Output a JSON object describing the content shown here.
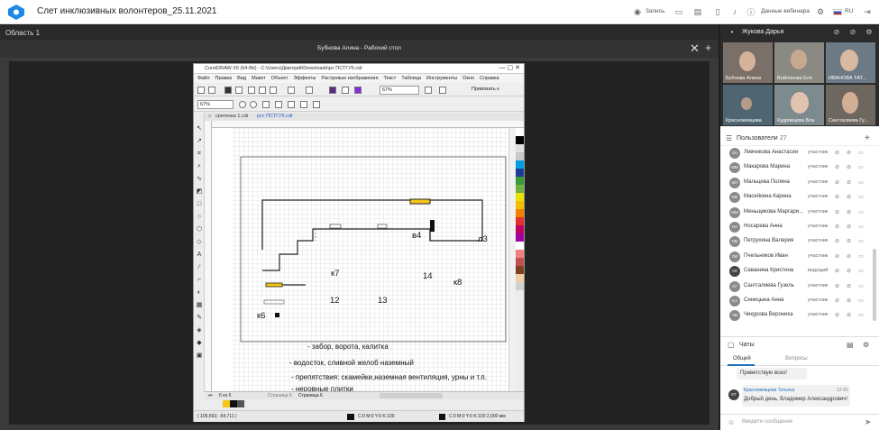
{
  "app": {
    "title": "Слет инклюзивных волонтеров_25.11.2021",
    "record_label": "Запись",
    "webinar_data_label": "Данные вебинара",
    "language": "RU",
    "accent_color": "#1e88e5"
  },
  "area": {
    "title": "Область 1"
  },
  "stage": {
    "title": "Бубнова Алина - Рабочий стол"
  },
  "corel": {
    "title": "CorelDRAW X6 (64-Bit) - C:\\Users\\Дмитрий\\Downloads\\рс ПСТГУ5.cdr",
    "menu": [
      "Файл",
      "Правка",
      "Вид",
      "Макет",
      "Объект",
      "Эффекты",
      "Растровые изображения",
      "Текст",
      "Таблица",
      "Инструменты",
      "Окно",
      "Справка"
    ],
    "zoom1": "67%",
    "zoom2": "67%",
    "snap_label": "Привязать к",
    "tabs": [
      "сретенка 1.cdr",
      "рсс ПСТГУ5.cdr"
    ],
    "page_nav": "6 из 6",
    "pages": [
      "Страница 5",
      "Страница 6"
    ],
    "coords": "( 105,663; -54,711 )",
    "fill_status": "C:0 M:0 Y:0 K:100",
    "outline_status": "C:0 M:0 Y:0 K:100  2,000 мм",
    "drawing": {
      "labels": [
        "в4",
        "л3",
        "к7",
        "14",
        "к8",
        "12",
        "13",
        "к6"
      ],
      "legend": [
        "- забор, ворота, калитка",
        "- водосток, сливной желоб наземный",
        "- препятствия: скамейки,наземная вентиляция, урны и т.п.",
        "- неровные плитки"
      ]
    },
    "palette": [
      "#ffffff",
      "#000000",
      "#e0e0e0",
      "#c8c8c8",
      "#00a0e0",
      "#1e3c96",
      "#3a9a3a",
      "#70b040",
      "#e8e000",
      "#f0c000",
      "#f08000",
      "#e03030",
      "#c00060",
      "#a000a0",
      "#ffffff",
      "#f08080",
      "#c05050",
      "#804020",
      "#f0d0a0",
      "#d0d0d0"
    ]
  },
  "panel": {
    "user": "Жукова Дарья",
    "videos": [
      "Бубнова Алина",
      "Войлокова Еле",
      "ИВАНОВА ТАТ...",
      "Красножевцева",
      "Кудрявцева Вла",
      "Сантгалиева Гу..."
    ],
    "users_title": "Пользователи",
    "users_count": "27",
    "users": [
      {
        "initials": "ЛА",
        "name": "Ливчикова Анастасия",
        "role": "участник",
        "color": "#8a8a8a"
      },
      {
        "initials": "ММ",
        "name": "Макарова Марина",
        "role": "участник",
        "color": "#8a8a8a"
      },
      {
        "initials": "МП",
        "name": "Мальцева Полина",
        "role": "участник",
        "color": "#8a8a8a"
      },
      {
        "initials": "МК",
        "name": "Масейкина Карина",
        "role": "участник",
        "color": "#8a8a8a"
      },
      {
        "initials": "ММ",
        "name": "Меньщикова Маргари...",
        "role": "участник",
        "color": "#8a8a8a"
      },
      {
        "initials": "НА",
        "name": "Носарева Анна",
        "role": "участник",
        "color": "#8a8a8a"
      },
      {
        "initials": "ПВ",
        "name": "Петрухина Валерия",
        "role": "участник",
        "color": "#8a8a8a"
      },
      {
        "initials": "ПИ",
        "name": "Пчельников Иван",
        "role": "участник",
        "color": "#8a8a8a"
      },
      {
        "initials": "СК",
        "name": "Саванина Кристина",
        "role": "ведущий",
        "color": "#444444"
      },
      {
        "initials": "СГ",
        "name": "Сантгалиева Гузель",
        "role": "участник",
        "color": "#8a8a8a"
      },
      {
        "initials": "СА",
        "name": "Синицына Анна",
        "role": "участник",
        "color": "#8a8a8a"
      },
      {
        "initials": "ЧВ",
        "name": "Чикурова Вероника",
        "role": "участник",
        "color": "#8a8a8a"
      }
    ],
    "chat_title": "Чаты",
    "tab_general": "Общий",
    "tab_questions": "Вопросы",
    "msg1": "Приветствую всех!",
    "msg2_initials": "КТ",
    "msg2_author": "Красножевцева Татьяна",
    "msg2_time": "12:43",
    "msg2_text": "Добрый день, Владимир Александрович!",
    "input_placeholder": "Введите сообщение"
  }
}
